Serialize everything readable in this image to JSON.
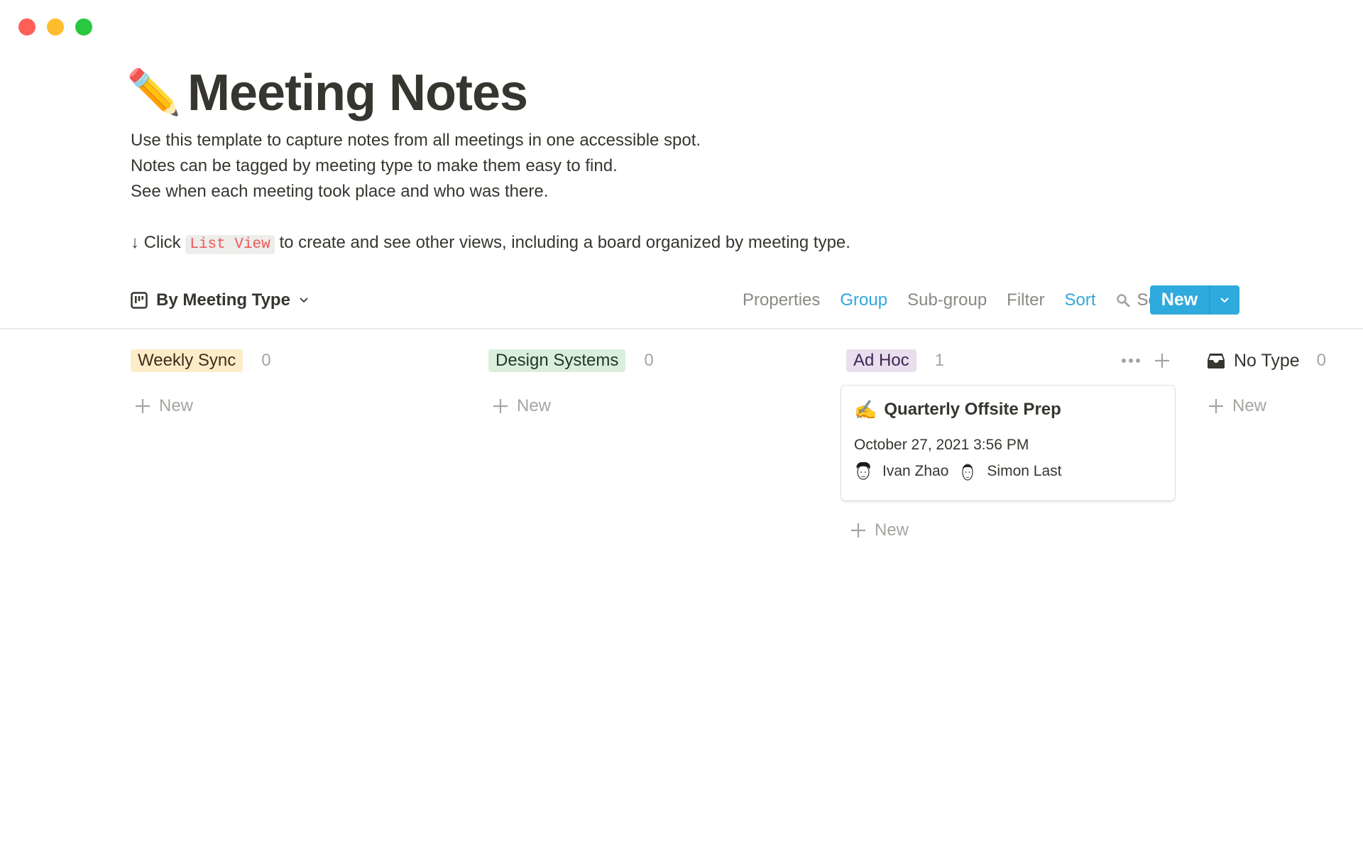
{
  "window": {
    "controls": [
      "close",
      "minimize",
      "maximize"
    ]
  },
  "page": {
    "icon": "✏️",
    "title": "Meeting Notes",
    "description": [
      "Use this template to capture notes from all meetings in one accessible spot.",
      "Notes can be tagged by meeting type to make them easy to find.",
      "See when each meeting took place and who was there."
    ],
    "hint": {
      "arrow": "↓",
      "prefix": "Click",
      "code": "List View",
      "suffix": "to create and see other views, including a board organized by meeting type."
    }
  },
  "toolbar": {
    "view_name": "By Meeting Type",
    "actions": {
      "properties": "Properties",
      "group": "Group",
      "subgroup": "Sub-group",
      "filter": "Filter",
      "sort": "Sort",
      "search": "Search"
    },
    "new_label": "New",
    "accent": "#2eaadc"
  },
  "board": {
    "columns": [
      {
        "label": "Weekly Sync",
        "count": "0",
        "bg": "#fdecc8",
        "fg": "#402c1b",
        "new_label": "New"
      },
      {
        "label": "Design Systems",
        "count": "0",
        "bg": "#dbeddb",
        "fg": "#1c3829",
        "new_label": "New"
      },
      {
        "label": "Ad Hoc",
        "count": "1",
        "bg": "#e8deee",
        "fg": "#412454",
        "new_label": "New",
        "cards": [
          {
            "icon": "✍️",
            "title": "Quarterly Offsite Prep",
            "date": "October 27, 2021 3:56 PM",
            "people": [
              "Ivan Zhao",
              "Simon Last"
            ]
          }
        ]
      },
      {
        "label": "No Type",
        "count": "0",
        "new_label": "New"
      }
    ]
  }
}
